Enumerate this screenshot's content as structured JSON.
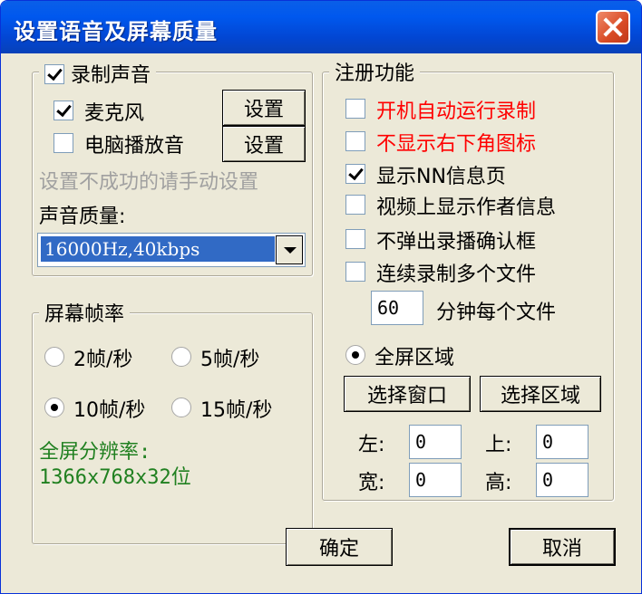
{
  "window": {
    "title": "设置语音及屏幕质量"
  },
  "record": {
    "title": "录制声音",
    "title_checked": true,
    "mic_label": "麦克风",
    "mic_checked": true,
    "mic_settings_btn": "设置",
    "pc_label": "电脑播放音",
    "pc_checked": false,
    "pc_settings_btn": "设置",
    "hint": "设置不成功的请手动设置",
    "quality_label": "声音质量:",
    "quality_value": "16000Hz,40kbps"
  },
  "screen": {
    "title": "屏幕帧率",
    "options": [
      {
        "label": "2帧/秒",
        "selected": false
      },
      {
        "label": "5帧/秒",
        "selected": false
      },
      {
        "label": "10帧/秒",
        "selected": true
      },
      {
        "label": "15帧/秒",
        "selected": false
      }
    ],
    "resolution_label": "全屏分辨率:",
    "resolution_value": "1366x768x32位"
  },
  "register": {
    "title": "注册功能",
    "items": [
      {
        "label": "开机自动运行录制",
        "checked": false,
        "color": "#ff0000"
      },
      {
        "label": "不显示右下角图标",
        "checked": false,
        "color": "#ff0000"
      },
      {
        "label": "显示NN信息页",
        "checked": true,
        "color": "#000000"
      },
      {
        "label": "视频上显示作者信息",
        "checked": false,
        "color": "#000000"
      },
      {
        "label": "不弹出录播确认框",
        "checked": false,
        "color": "#000000"
      },
      {
        "label": "连续录制多个文件",
        "checked": false,
        "color": "#000000"
      }
    ],
    "minutes_value": "60",
    "minutes_label": "分钟每个文件",
    "fullscreen_label": "全屏区域",
    "fullscreen_selected": true,
    "select_window_btn": "选择窗口",
    "select_area_btn": "选择区域",
    "left_label": "左:",
    "left_value": "0",
    "top_label": "上:",
    "top_value": "0",
    "width_label": "宽:",
    "width_value": "0",
    "height_label": "高:",
    "height_value": "0"
  },
  "footer": {
    "ok": "确定",
    "cancel": "取消"
  }
}
